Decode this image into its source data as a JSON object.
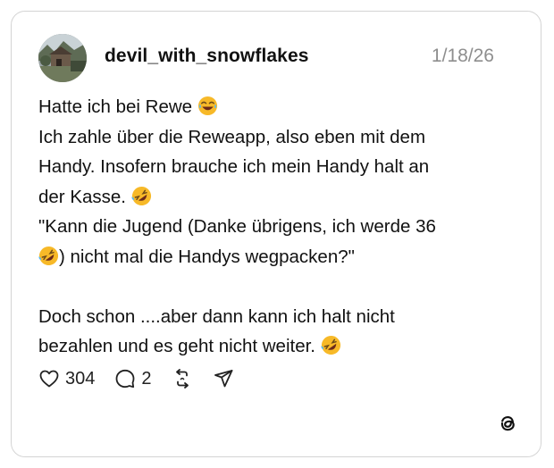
{
  "post": {
    "username": "devil_with_snowflakes",
    "date": "1/18/26",
    "lines": [
      {
        "text": "Hatte ich bei Rewe",
        "emoji": "joy"
      },
      {
        "text": "Ich zahle über die Reweapp, also eben mit dem"
      },
      {
        "text": "Handy. Insofern brauche ich mein Handy halt an"
      },
      {
        "text": "der Kasse.",
        "emoji": "rofl"
      },
      {
        "text": "\"Kann die Jugend (Danke übrigens, ich werde 36"
      },
      {
        "text": ") nicht mal die Handys wegpacken?\"",
        "emoji_before": "rofl"
      },
      {
        "text": ""
      },
      {
        "text": "Doch schon ....aber dann kann ich halt nicht"
      },
      {
        "text": "bezahlen und es geht nicht weiter.",
        "emoji": "rofl"
      }
    ]
  },
  "actions": {
    "likes": "304",
    "replies": "2",
    "icons": [
      "heart-icon",
      "comment-icon",
      "repost-icon",
      "share-icon"
    ]
  },
  "brand": {
    "logo": "threads-icon",
    "emoji_color": "#F7B928",
    "text_color": "#111111",
    "muted_color": "#8e8e8e"
  }
}
